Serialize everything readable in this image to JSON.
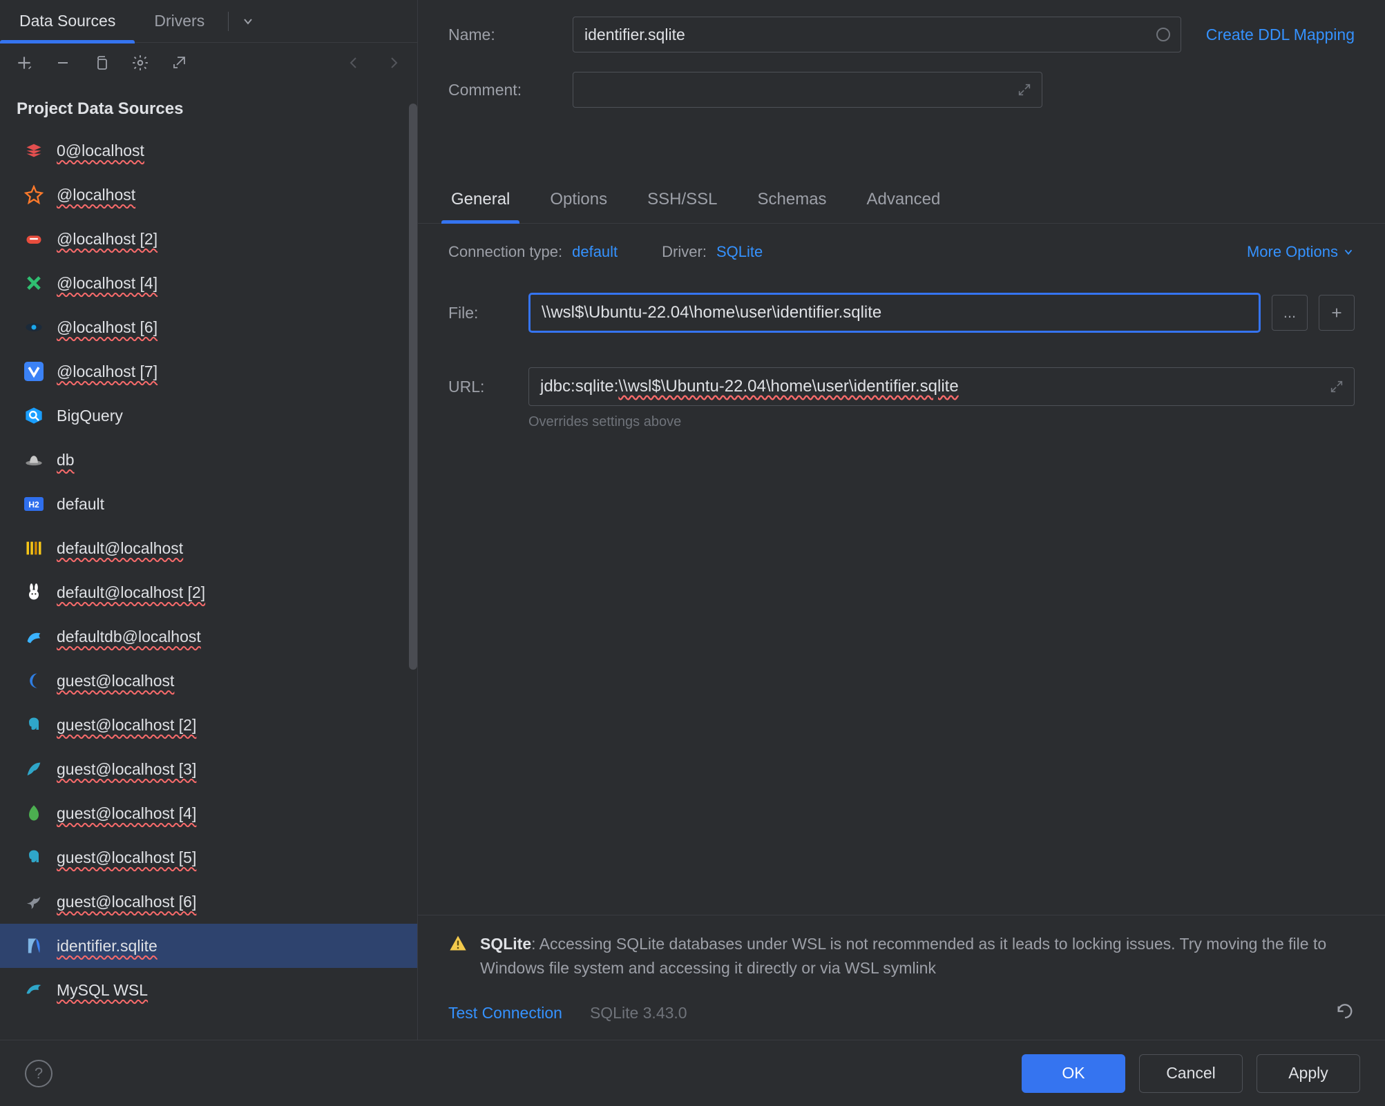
{
  "sidebar": {
    "tabs": {
      "data_sources": "Data Sources",
      "drivers": "Drivers"
    },
    "section_title": "Project Data Sources",
    "items": [
      {
        "label": "0@localhost",
        "icon_color": "#e34f4f",
        "icon_shape": "redis",
        "spell": true
      },
      {
        "label": "@localhost",
        "icon_color": "#ff7a2b",
        "icon_shape": "star",
        "spell": true
      },
      {
        "label": "@localhost [2]",
        "icon_color": "#e84d3d",
        "icon_shape": "couch",
        "spell": true
      },
      {
        "label": "@localhost [4]",
        "icon_color": "#2fbf71",
        "icon_shape": "x",
        "spell": true
      },
      {
        "label": "@localhost [6]",
        "icon_color": "#1aa7ec",
        "icon_shape": "eye",
        "spell": true
      },
      {
        "label": "@localhost [7]",
        "icon_color": "#3b82f6",
        "icon_shape": "v",
        "spell": true
      },
      {
        "label": "BigQuery",
        "icon_color": "#1a9fff",
        "icon_shape": "bq",
        "spell": false
      },
      {
        "label": "db",
        "icon_color": "#c8c8c8",
        "icon_shape": "hat",
        "spell": true
      },
      {
        "label": "default",
        "icon_color": "#2f6fed",
        "icon_shape": "h2",
        "spell": false
      },
      {
        "label": "default@localhost",
        "icon_color": "#f5c518",
        "icon_shape": "bars",
        "spell": true
      },
      {
        "label": "default@localhost [2]",
        "icon_color": "#ffffff",
        "icon_shape": "bunny",
        "spell": true
      },
      {
        "label": "defaultdb@localhost",
        "icon_color": "#3bb3ff",
        "icon_shape": "dragon",
        "spell": true
      },
      {
        "label": "guest@localhost",
        "icon_color": "#2f7de1",
        "icon_shape": "moon",
        "spell": true
      },
      {
        "label": "guest@localhost [2]",
        "icon_color": "#2fa6c9",
        "icon_shape": "eleph",
        "spell": true
      },
      {
        "label": "guest@localhost [3]",
        "icon_color": "#2fa6c9",
        "icon_shape": "feather",
        "spell": true
      },
      {
        "label": "guest@localhost [4]",
        "icon_color": "#4caf50",
        "icon_shape": "leaf",
        "spell": true
      },
      {
        "label": "guest@localhost [5]",
        "icon_color": "#2fa6c9",
        "icon_shape": "eleph",
        "spell": true
      },
      {
        "label": "guest@localhost [6]",
        "icon_color": "#8a8f98",
        "icon_shape": "bird",
        "spell": true
      },
      {
        "label": "identifier.sqlite",
        "icon_color": "#3b82f6",
        "icon_shape": "sqlite",
        "spell": true,
        "selected": true
      },
      {
        "label": "MySQL WSL",
        "icon_color": "#2fa6c9",
        "icon_shape": "dolphin",
        "spell": true
      }
    ]
  },
  "form": {
    "name_label": "Name:",
    "name_value": "identifier.sqlite",
    "comment_label": "Comment:",
    "comment_value": "",
    "create_mapping": "Create DDL Mapping"
  },
  "subtabs": {
    "general": "General",
    "options": "Options",
    "ssh": "SSH/SSL",
    "schemas": "Schemas",
    "advanced": "Advanced"
  },
  "conn": {
    "type_label": "Connection type:",
    "type_value": "default",
    "driver_label": "Driver:",
    "driver_value": "SQLite",
    "more": "More Options"
  },
  "file": {
    "label": "File:",
    "value": "\\\\wsl$\\Ubuntu-22.04\\home\\user\\identifier.sqlite",
    "browse": "...",
    "url_label": "URL:",
    "url_prefix": "jdbc:sqlite:",
    "url_path": "\\\\wsl$\\Ubuntu-22.04\\home\\user\\identifier.sqlite",
    "hint": "Overrides settings above"
  },
  "warning": {
    "title": "SQLite",
    "text": ": Accessing SQLite databases under WSL is not recommended as it leads to locking issues. Try moving the file to Windows file system and accessing it directly or via WSL symlink"
  },
  "footer": {
    "test": "Test Connection",
    "driver_version": "SQLite 3.43.0",
    "ok": "OK",
    "cancel": "Cancel",
    "apply": "Apply",
    "help": "?"
  }
}
